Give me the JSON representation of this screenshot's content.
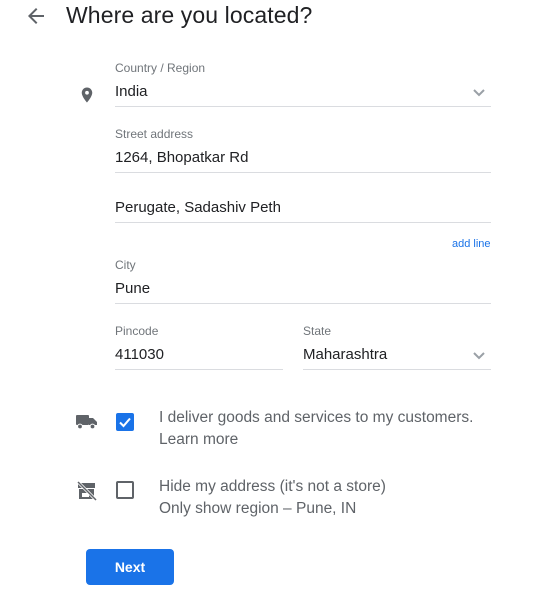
{
  "header": {
    "title": "Where are you located?",
    "back_icon": "arrow-back-icon"
  },
  "form": {
    "country": {
      "label": "Country / Region",
      "value": "India",
      "icon": "location-pin-icon"
    },
    "street": {
      "label": "Street address",
      "line1": "1264, Bhopatkar Rd",
      "line2": "Perugate, Sadashiv Peth"
    },
    "add_line": "add line",
    "city": {
      "label": "City",
      "value": "Pune"
    },
    "pincode": {
      "label": "Pincode",
      "value": "411030"
    },
    "state": {
      "label": "State",
      "value": "Maharashtra"
    }
  },
  "options": {
    "deliver": {
      "icon": "delivery-truck-icon",
      "checked": true,
      "text": "I deliver goods and services to my customers.",
      "link": "Learn more"
    },
    "hide_address": {
      "icon": "store-off-icon",
      "checked": false,
      "text": "Hide my address (it's not a store)",
      "subtext": "Only show region – Pune, IN"
    }
  },
  "actions": {
    "next": "Next"
  },
  "colors": {
    "accent": "#1a73e8",
    "icon": "#5f6368",
    "divider": "#dadce0"
  }
}
